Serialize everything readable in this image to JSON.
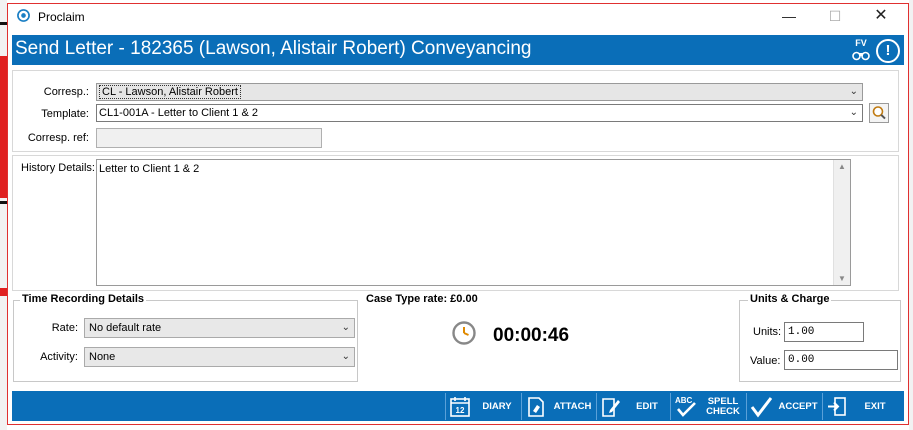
{
  "window": {
    "title": "Proclaim"
  },
  "header": {
    "title": "Send Letter - 182365 (Lawson, Alistair Robert) Conveyancing",
    "fv_label": "FV"
  },
  "form": {
    "corresp_label": "Corresp.:",
    "corresp_value": "CL - Lawson, Alistair Robert",
    "template_label": "Template:",
    "template_value": "CL1-001A - Letter to Client 1 & 2",
    "corresp_ref_label": "Corresp. ref:",
    "corresp_ref_value": "",
    "history_label": "History Details:",
    "history_value": "Letter to Client 1 & 2"
  },
  "time_recording": {
    "legend": "Time Recording Details",
    "rate_label": "Rate:",
    "rate_value": "No default rate",
    "activity_label": "Activity:",
    "activity_value": "None"
  },
  "case_type_rate": "Case Type rate: £0.00",
  "timer": "00:00:46",
  "units_charge": {
    "legend": "Units & Charge",
    "units_label": "Units:",
    "units_value": "1.00",
    "value_label": "Value:",
    "value_value": "0.00"
  },
  "toolbar": {
    "diary": "DIARY",
    "diary_icon_text": "12",
    "attach": "ATTACH",
    "edit": "EDIT",
    "spell_line1": "SPELL",
    "spell_line2": "CHECK",
    "spell_icon_text": "ABC",
    "accept": "ACCEPT",
    "exit": "EXIT"
  },
  "colors": {
    "accent": "#0a6eb8",
    "frame_border": "#e03030"
  }
}
